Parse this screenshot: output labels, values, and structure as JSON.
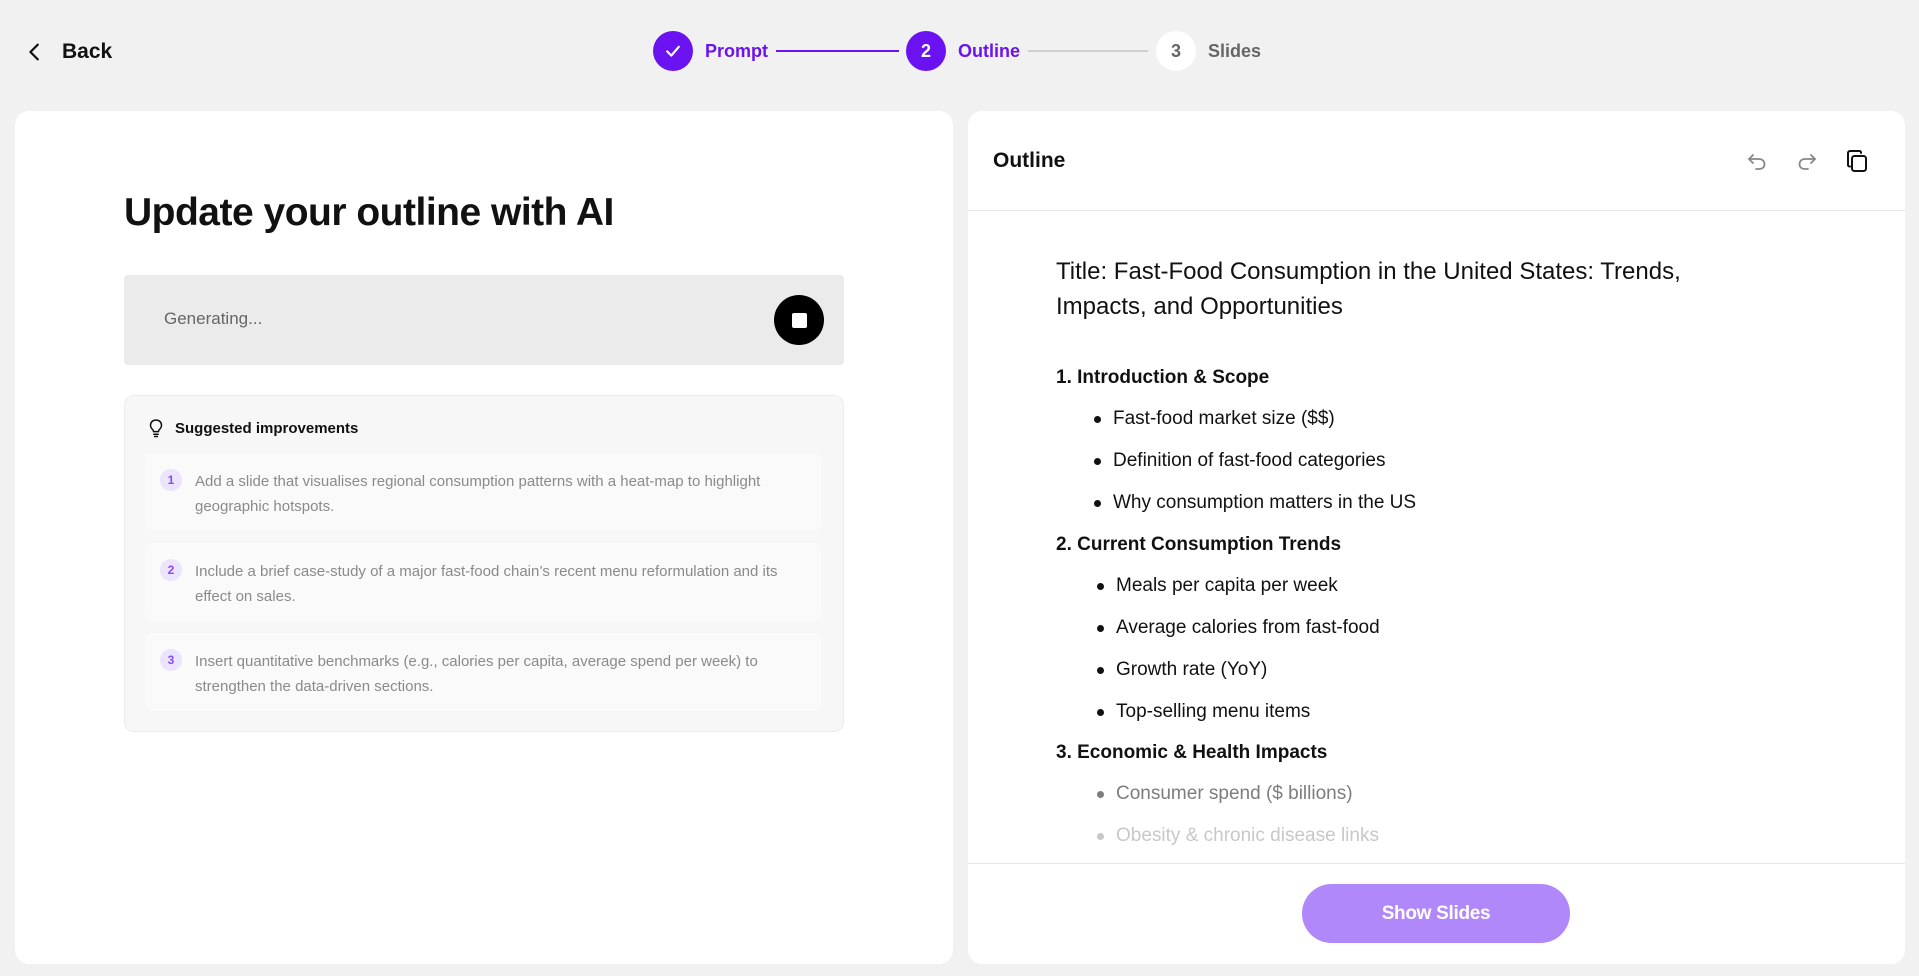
{
  "nav": {
    "back_label": "Back"
  },
  "stepper": {
    "steps": [
      {
        "number": "",
        "label": "Prompt",
        "state": "done"
      },
      {
        "number": "2",
        "label": "Outline",
        "state": "active"
      },
      {
        "number": "3",
        "label": "Slides",
        "state": "inactive"
      }
    ]
  },
  "left": {
    "heading": "Update your outline with AI",
    "generating_text": "Generating...",
    "suggestions": {
      "title": "Suggested improvements",
      "items": [
        {
          "number": "1",
          "text": "Add a slide that visualises regional consumption patterns with a heat-map to highlight geographic hotspots."
        },
        {
          "number": "2",
          "text": "Include a brief case-study of a major fast-food chain’s recent menu reformulation and its effect on sales."
        },
        {
          "number": "3",
          "text": "Insert quantitative benchmarks (e.g., calories per capita, average spend per week) to strengthen the data-driven sections."
        }
      ]
    }
  },
  "outline": {
    "header_title": "Outline",
    "doc_title": "Title: Fast-Food Consumption in the United States: Trends, Impacts, and Opportunities",
    "sections": [
      {
        "title": "1. Introduction & Scope",
        "bullets": [
          "Fast-food market size ($$)",
          "Definition of fast-food categories",
          "Why consumption matters in the US"
        ]
      },
      {
        "title": "2. Current Consumption Trends",
        "bullets": [
          "Meals per capita per week",
          "Average calories from fast-food",
          "Growth rate (YoY)",
          "Top-selling menu items"
        ]
      },
      {
        "title": "3. Economic & Health Impacts",
        "bullets": [
          "Consumer spend ($ billions)",
          "Obesity & chronic disease links"
        ]
      }
    ],
    "show_slides_label": "Show Slides"
  },
  "colors": {
    "accent": "#6a12f0",
    "button": "#b188f9",
    "background": "#f1f1f1"
  },
  "icons": [
    "chevron-left-icon",
    "check-icon",
    "stop-icon",
    "lightbulb-icon",
    "undo-icon",
    "redo-icon",
    "copy-icon"
  ]
}
